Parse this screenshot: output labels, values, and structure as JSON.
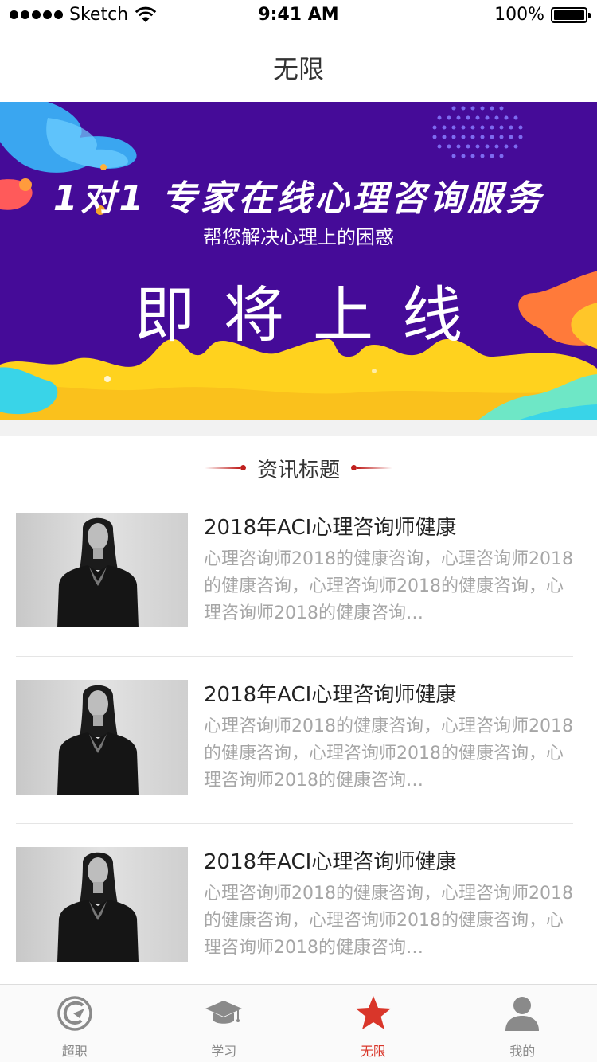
{
  "status_bar": {
    "carrier": "Sketch",
    "time": "9:41 AM",
    "battery": "100%"
  },
  "nav": {
    "title": "无限"
  },
  "banner": {
    "headline": "1对1 专家在线心理咨询服务",
    "subtitle": "帮您解决心理上的困惑",
    "launch_text": "即将上线",
    "colors": {
      "background": "#450b98",
      "yellow": "#ffd21e",
      "cyan": "#39d4e8"
    }
  },
  "section": {
    "title": "资讯标题",
    "accent": "#c0201e"
  },
  "news": [
    {
      "title": "2018年ACI心理咨询师健康",
      "desc": "心理咨询师2018的健康咨询，心理咨询师2018的健康咨询，心理咨询师2018的健康咨询，心理咨询师2018的健康咨询…"
    },
    {
      "title": "2018年ACI心理咨询师健康",
      "desc": "心理咨询师2018的健康咨询，心理咨询师2018的健康咨询，心理咨询师2018的健康咨询，心理咨询师2018的健康咨询…"
    },
    {
      "title": "2018年ACI心理咨询师健康",
      "desc": "心理咨询师2018的健康咨询，心理咨询师2018的健康咨询，心理咨询师2018的健康咨询，心理咨询师2018的健康咨询…"
    }
  ],
  "tabs": [
    {
      "label": "超职",
      "icon": "chaozhi-logo-icon",
      "active": false
    },
    {
      "label": "学习",
      "icon": "graduation-cap-icon",
      "active": false
    },
    {
      "label": "无限",
      "icon": "star-icon",
      "active": true
    },
    {
      "label": "我的",
      "icon": "user-icon",
      "active": false
    }
  ],
  "colors": {
    "active_tab": "#d9362a",
    "inactive_tab": "#8a8a8a"
  }
}
